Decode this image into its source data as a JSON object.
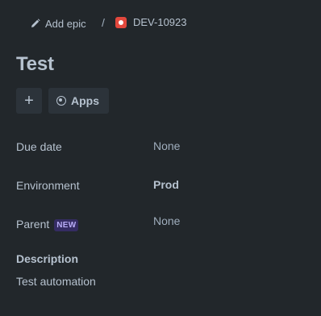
{
  "breadcrumb": {
    "add_epic_label": "Add epic",
    "separator": "/",
    "issue_key": "DEV-10923"
  },
  "issue": {
    "title": "Test"
  },
  "toolbar": {
    "add_label": "+",
    "apps_label": "Apps"
  },
  "fields": {
    "due_date": {
      "label": "Due date",
      "value": "None"
    },
    "environment": {
      "label": "Environment",
      "value": "Prod"
    },
    "parent": {
      "label": "Parent",
      "badge": "NEW",
      "value": "None"
    }
  },
  "description": {
    "heading": "Description",
    "body": "Test automation"
  },
  "icons": {
    "add_epic": "pencil-icon",
    "issue_type": "bug-icon",
    "apps": "apps-icon"
  },
  "colors": {
    "background": "#22272b",
    "button_bg": "#2c333a",
    "bug_red": "#e2483d",
    "new_badge_text": "#b8acf6",
    "new_badge_bg": "#352c63"
  }
}
